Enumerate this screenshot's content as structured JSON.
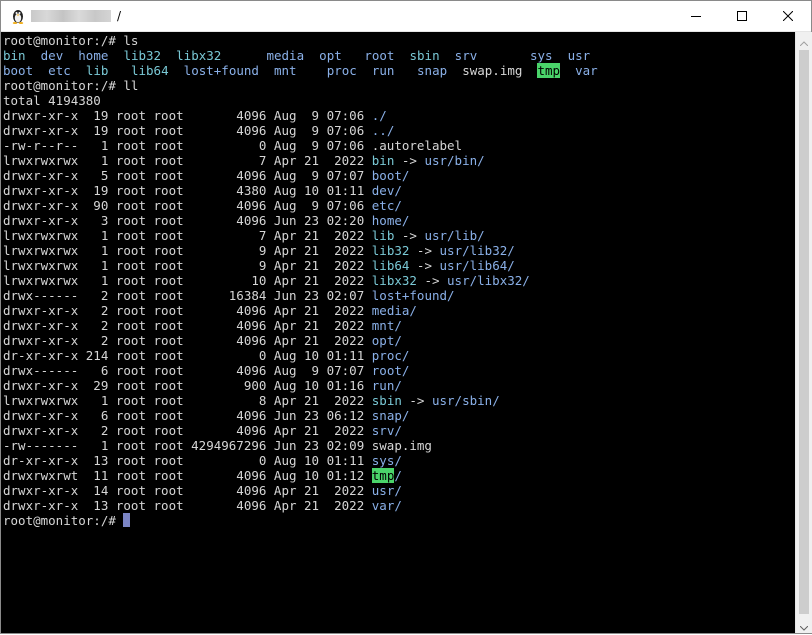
{
  "window": {
    "title_path": "/",
    "icon": "linux-penguin-icon"
  },
  "controls": {
    "minimize": "minimize-icon",
    "maximize": "maximize-icon",
    "close": "close-icon"
  },
  "colors": {
    "directory": "#8ab0e8",
    "symlink": "#7ac9d6",
    "tmp_highlight_bg": "#4ad46a",
    "text": "#d6d6d6",
    "cursor": "#7c86c6"
  },
  "terminal": {
    "lines": [
      [
        {
          "t": "root@monitor:/# ls",
          "c": "white"
        }
      ],
      [
        {
          "t": "bin",
          "c": "link"
        },
        {
          "t": "  "
        },
        {
          "t": "dev",
          "c": "dir"
        },
        {
          "t": "  "
        },
        {
          "t": "home",
          "c": "dir"
        },
        {
          "t": "  "
        },
        {
          "t": "lib32",
          "c": "link"
        },
        {
          "t": "  "
        },
        {
          "t": "libx32",
          "c": "link"
        },
        {
          "t": "      "
        },
        {
          "t": "media",
          "c": "dir"
        },
        {
          "t": "  "
        },
        {
          "t": "opt",
          "c": "dir"
        },
        {
          "t": "   "
        },
        {
          "t": "root",
          "c": "dir"
        },
        {
          "t": "  "
        },
        {
          "t": "sbin",
          "c": "link"
        },
        {
          "t": "  "
        },
        {
          "t": "srv",
          "c": "dir"
        },
        {
          "t": "       "
        },
        {
          "t": "sys",
          "c": "dir"
        },
        {
          "t": "  "
        },
        {
          "t": "usr",
          "c": "dir"
        }
      ],
      [
        {
          "t": "boot",
          "c": "dir"
        },
        {
          "t": "  "
        },
        {
          "t": "etc",
          "c": "dir"
        },
        {
          "t": "  "
        },
        {
          "t": "lib",
          "c": "link"
        },
        {
          "t": "   "
        },
        {
          "t": "lib64",
          "c": "link"
        },
        {
          "t": "  "
        },
        {
          "t": "lost+found",
          "c": "dir"
        },
        {
          "t": "  "
        },
        {
          "t": "mnt",
          "c": "dir"
        },
        {
          "t": "    "
        },
        {
          "t": "proc",
          "c": "dir"
        },
        {
          "t": "  "
        },
        {
          "t": "run",
          "c": "dir"
        },
        {
          "t": "   "
        },
        {
          "t": "snap",
          "c": "dir"
        },
        {
          "t": "  "
        },
        {
          "t": "swap.img",
          "c": "white"
        },
        {
          "t": "  "
        },
        {
          "t": "tmp",
          "c": "tmp"
        },
        {
          "t": "  "
        },
        {
          "t": "var",
          "c": "dir"
        }
      ],
      [
        {
          "t": "root@monitor:/# ll",
          "c": "white"
        }
      ],
      [
        {
          "t": "total 4194380",
          "c": "white"
        }
      ],
      [
        {
          "t": "drwxr-xr-x  19 root root       4096 Aug  9 07:06 "
        },
        {
          "t": "./",
          "c": "dir"
        }
      ],
      [
        {
          "t": "drwxr-xr-x  19 root root       4096 Aug  9 07:06 "
        },
        {
          "t": "../",
          "c": "dir"
        }
      ],
      [
        {
          "t": "-rw-r--r--   1 root root          0 Aug  9 07:06 .autorelabel"
        }
      ],
      [
        {
          "t": "lrwxrwxrwx   1 root root          7 Apr 21  2022 "
        },
        {
          "t": "bin",
          "c": "link"
        },
        {
          "t": " -> "
        },
        {
          "t": "usr/bin/",
          "c": "dir"
        }
      ],
      [
        {
          "t": "drwxr-xr-x   5 root root       4096 Aug  9 07:07 "
        },
        {
          "t": "boot/",
          "c": "dir"
        }
      ],
      [
        {
          "t": "drwxr-xr-x  19 root root       4380 Aug 10 01:11 "
        },
        {
          "t": "dev/",
          "c": "dir"
        }
      ],
      [
        {
          "t": "drwxr-xr-x  90 root root       4096 Aug  9 07:06 "
        },
        {
          "t": "etc/",
          "c": "dir"
        }
      ],
      [
        {
          "t": "drwxr-xr-x   3 root root       4096 Jun 23 02:20 "
        },
        {
          "t": "home/",
          "c": "dir"
        }
      ],
      [
        {
          "t": "lrwxrwxrwx   1 root root          7 Apr 21  2022 "
        },
        {
          "t": "lib",
          "c": "link"
        },
        {
          "t": " -> "
        },
        {
          "t": "usr/lib/",
          "c": "dir"
        }
      ],
      [
        {
          "t": "lrwxrwxrwx   1 root root          9 Apr 21  2022 "
        },
        {
          "t": "lib32",
          "c": "link"
        },
        {
          "t": " -> "
        },
        {
          "t": "usr/lib32/",
          "c": "dir"
        }
      ],
      [
        {
          "t": "lrwxrwxrwx   1 root root          9 Apr 21  2022 "
        },
        {
          "t": "lib64",
          "c": "link"
        },
        {
          "t": " -> "
        },
        {
          "t": "usr/lib64/",
          "c": "dir"
        }
      ],
      [
        {
          "t": "lrwxrwxrwx   1 root root         10 Apr 21  2022 "
        },
        {
          "t": "libx32",
          "c": "link"
        },
        {
          "t": " -> "
        },
        {
          "t": "usr/libx32/",
          "c": "dir"
        }
      ],
      [
        {
          "t": "drwx------   2 root root      16384 Jun 23 02:07 "
        },
        {
          "t": "lost+found/",
          "c": "dir"
        }
      ],
      [
        {
          "t": "drwxr-xr-x   2 root root       4096 Apr 21  2022 "
        },
        {
          "t": "media/",
          "c": "dir"
        }
      ],
      [
        {
          "t": "drwxr-xr-x   2 root root       4096 Apr 21  2022 "
        },
        {
          "t": "mnt/",
          "c": "dir"
        }
      ],
      [
        {
          "t": "drwxr-xr-x   2 root root       4096 Apr 21  2022 "
        },
        {
          "t": "opt/",
          "c": "dir"
        }
      ],
      [
        {
          "t": "dr-xr-xr-x 214 root root          0 Aug 10 01:11 "
        },
        {
          "t": "proc/",
          "c": "dir"
        }
      ],
      [
        {
          "t": "drwx------   6 root root       4096 Aug  9 07:07 "
        },
        {
          "t": "root/",
          "c": "dir"
        }
      ],
      [
        {
          "t": "drwxr-xr-x  29 root root        900 Aug 10 01:16 "
        },
        {
          "t": "run/",
          "c": "dir"
        }
      ],
      [
        {
          "t": "lrwxrwxrwx   1 root root          8 Apr 21  2022 "
        },
        {
          "t": "sbin",
          "c": "link"
        },
        {
          "t": " -> "
        },
        {
          "t": "usr/sbin/",
          "c": "dir"
        }
      ],
      [
        {
          "t": "drwxr-xr-x   6 root root       4096 Jun 23 06:12 "
        },
        {
          "t": "snap/",
          "c": "dir"
        }
      ],
      [
        {
          "t": "drwxr-xr-x   2 root root       4096 Apr 21  2022 "
        },
        {
          "t": "srv/",
          "c": "dir"
        }
      ],
      [
        {
          "t": "-rw-------   1 root root 4294967296 Jun 23 02:09 swap.img"
        }
      ],
      [
        {
          "t": "dr-xr-xr-x  13 root root          0 Aug 10 01:11 "
        },
        {
          "t": "sys/",
          "c": "dir"
        }
      ],
      [
        {
          "t": "drwxrwxrwt  11 root root       4096 Aug 10 01:12 "
        },
        {
          "t": "tmp",
          "c": "tmp"
        },
        {
          "t": "/",
          "c": "dir"
        }
      ],
      [
        {
          "t": "drwxr-xr-x  14 root root       4096 Apr 21  2022 "
        },
        {
          "t": "usr/",
          "c": "dir"
        }
      ],
      [
        {
          "t": "drwxr-xr-x  13 root root       4096 Apr 21  2022 "
        },
        {
          "t": "var/",
          "c": "dir"
        }
      ],
      [
        {
          "t": "root@monitor:/# ",
          "c": "white"
        },
        {
          "cursor": true
        }
      ]
    ]
  }
}
